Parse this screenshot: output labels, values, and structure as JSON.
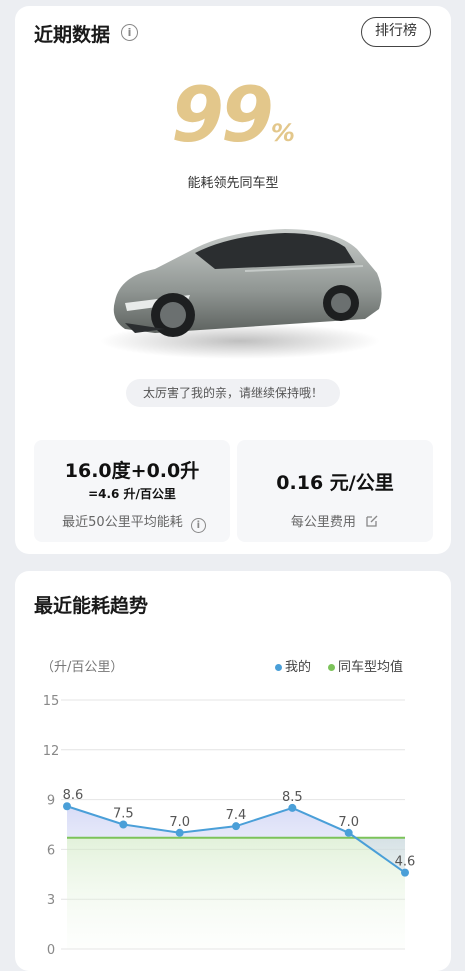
{
  "recent": {
    "title": "近期数据",
    "info_glyph": "i",
    "rank_button": "排行榜",
    "score_value": "99",
    "score_unit": "%",
    "lead_text": "能耗领先同车型",
    "praise": "太厉害了我的亲，请继续保持哦！",
    "stat_energy": {
      "main": "16.0度+0.0升",
      "sub": "=4.6 升/百公里",
      "caption": "最近50公里平均能耗"
    },
    "stat_cost": {
      "main": "0.16 元/公里",
      "caption": "每公里费用"
    }
  },
  "trend": {
    "title": "最近能耗趋势"
  },
  "colors": {
    "gold": "#e3c78b",
    "mine": "#4a9fd8",
    "average": "#7cc35a"
  },
  "chart_data": {
    "type": "line",
    "ylabel": "（升/百公里）",
    "ylim": [
      0,
      15
    ],
    "yticks": [
      0,
      3,
      6,
      9,
      12,
      15
    ],
    "x": [
      1,
      2,
      3,
      4,
      5,
      6,
      7
    ],
    "series": [
      {
        "name": "我的",
        "values": [
          8.6,
          7.5,
          7.0,
          7.4,
          8.5,
          7.0,
          4.6
        ],
        "color": "#4a9fd8"
      },
      {
        "name": "同车型均值",
        "values": [
          6.7,
          6.7,
          6.7,
          6.7,
          6.7,
          6.7,
          6.7
        ],
        "color": "#7cc35a"
      }
    ],
    "data_labels": [
      "8.6",
      "7.5",
      "7.0",
      "7.4",
      "8.5",
      "7.0",
      "4.6"
    ],
    "grid": true,
    "legend": "top-right"
  }
}
